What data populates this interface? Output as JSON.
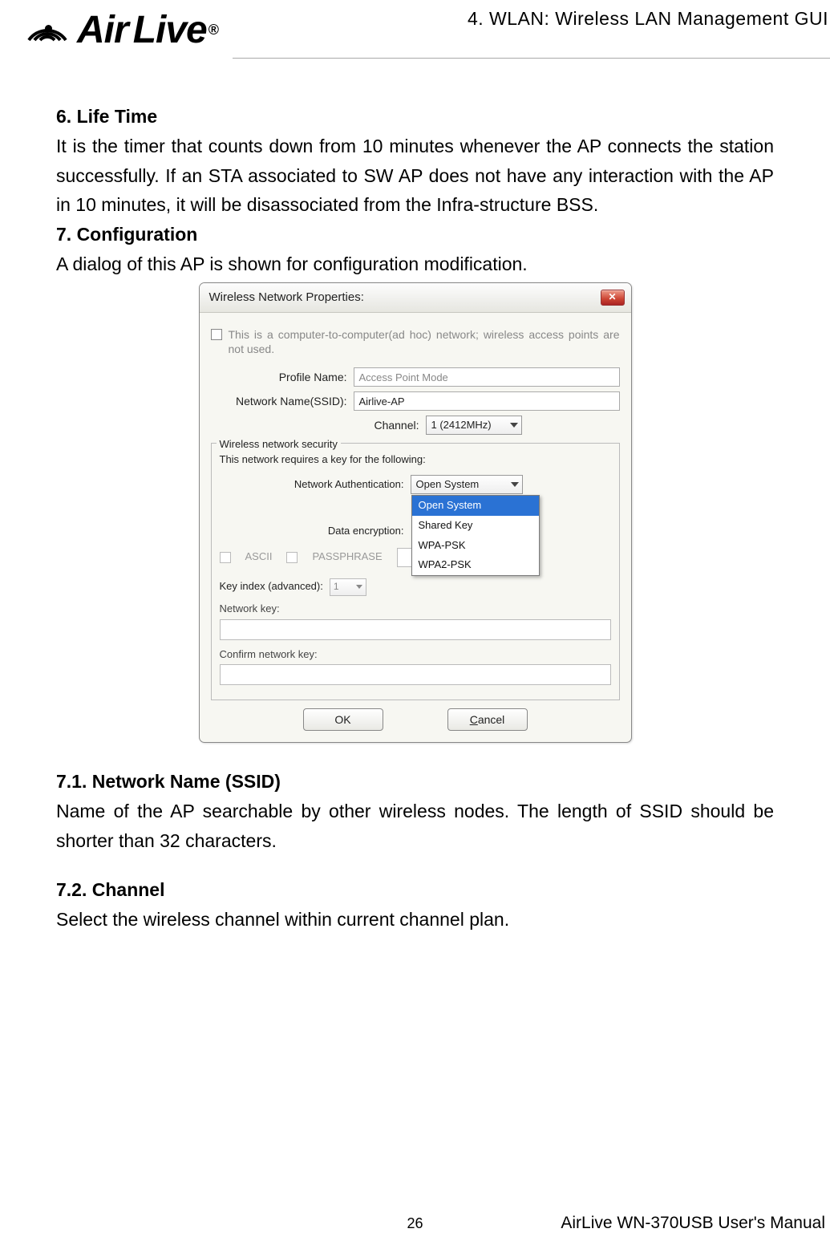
{
  "header": {
    "title": "4. WLAN: Wireless LAN Management GUI",
    "logo_text_air": "Air",
    "logo_text_live": "Live",
    "logo_reg": "®"
  },
  "body": {
    "s6_title": "6. Life Time",
    "s6_text": "It is the timer that counts down from 10 minutes whenever the AP connects the station successfully. If an STA associated to SW AP does not have any interaction with the AP in 10 minutes, it will be disassociated from the Infra-structure BSS.",
    "s7_title": "7. Configuration",
    "s7_text": "A dialog of this AP is shown for configuration modification.",
    "s71_title": "7.1. Network Name (SSID)",
    "s71_text": "Name of the AP searchable by other wireless nodes. The length of SSID should be shorter than 32 characters.",
    "s72_title": "7.2. Channel",
    "s72_text": "Select the wireless channel within current channel plan."
  },
  "dialog": {
    "title": "Wireless Network Properties:",
    "adhoc_text": "This is a computer-to-computer(ad hoc) network; wireless access points are not used.",
    "profile_name_label": "Profile Name:",
    "profile_name_value": "Access Point Mode",
    "ssid_label": "Network Name(SSID):",
    "ssid_value": "Airlive-AP",
    "channel_label": "Channel:",
    "channel_value": "1 (2412MHz)",
    "security_legend": "Wireless network security",
    "security_note": "This network requires a key for the following:",
    "net_auth_label": "Network Authentication:",
    "net_auth_value": "Open System",
    "auth_options": [
      "Open System",
      "Shared Key",
      "WPA-PSK",
      "WPA2-PSK"
    ],
    "data_enc_label": "Data encryption:",
    "ascii_label": "ASCII",
    "passphrase_label": "PASSPHRASE",
    "key_index_label": "Key index (advanced):",
    "key_index_value": "1",
    "net_key_label": "Network key:",
    "confirm_key_label": "Confirm network key:",
    "ok_label": "OK",
    "cancel_label_c": "C",
    "cancel_label_rest": "ancel"
  },
  "footer": {
    "page_number": "26",
    "manual": "AirLive WN-370USB User's Manual"
  }
}
